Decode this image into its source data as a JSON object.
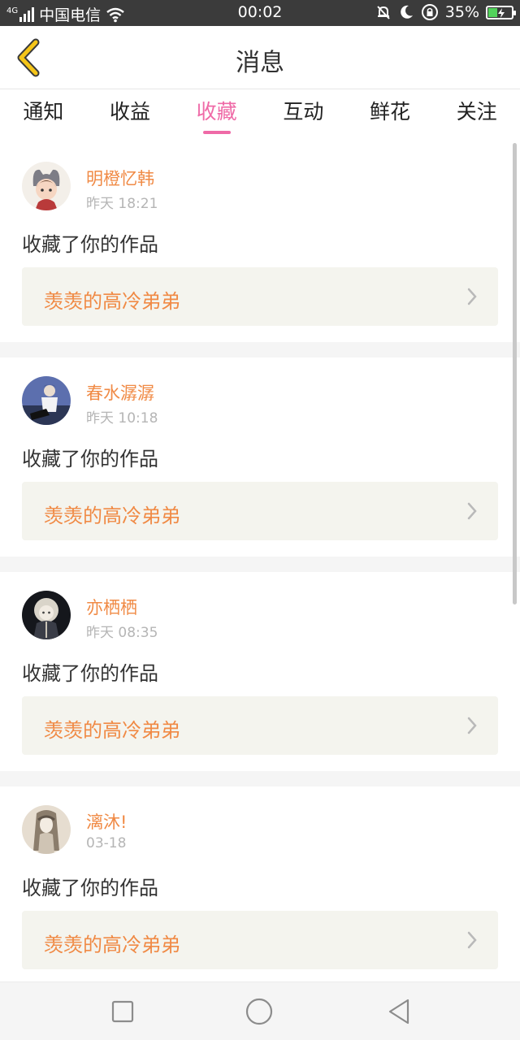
{
  "statusbar": {
    "network": "4G",
    "carrier": "中国电信",
    "time": "00:02",
    "battery_text": "35%",
    "battery_level": 0.35,
    "icons": [
      "signal-icon",
      "wifi-icon",
      "mute-bell-icon",
      "moon-icon",
      "rotation-lock-icon",
      "battery-icon"
    ]
  },
  "header": {
    "title": "消息",
    "back_icon": "chevron-left-icon",
    "accent_color": "#f5c518"
  },
  "tabs": [
    {
      "label": "通知"
    },
    {
      "label": "收益"
    },
    {
      "label": "收藏",
      "active": true
    },
    {
      "label": "互动"
    },
    {
      "label": "鲜花"
    },
    {
      "label": "关注"
    }
  ],
  "active_tab_color": "#ef6aa7",
  "items": [
    {
      "user": "明橙忆韩",
      "time": "昨天 18:21",
      "action": "收藏了你的作品",
      "work_title": "羡羡的高冷弟弟"
    },
    {
      "user": "春水潺潺",
      "time": "昨天 10:18",
      "action": "收藏了你的作品",
      "work_title": "羡羡的高冷弟弟"
    },
    {
      "user": "亦栖栖",
      "time": "昨天 08:35",
      "action": "收藏了你的作品",
      "work_title": "羡羡的高冷弟弟"
    },
    {
      "user": "漓沐!",
      "time": "03-18",
      "action": "收藏了你的作品",
      "work_title": "羡羡的高冷弟弟"
    }
  ],
  "name_color": "#f08a45",
  "navbar": {
    "icons": [
      "square-recents-icon",
      "circle-home-icon",
      "triangle-back-icon"
    ]
  }
}
